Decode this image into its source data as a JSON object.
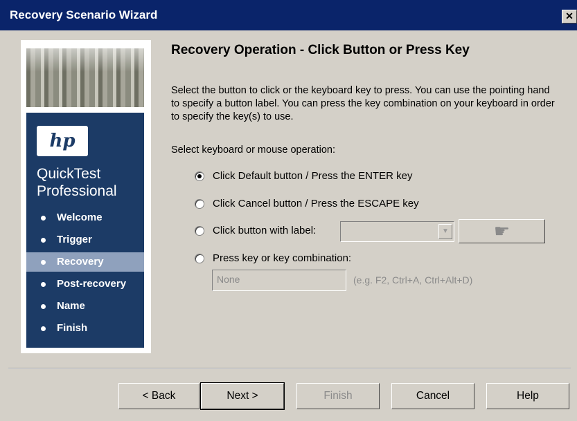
{
  "window": {
    "title": "Recovery Scenario Wizard",
    "close_symbol": "✕"
  },
  "sidebar": {
    "logo_text": "hp",
    "product_line1": "QuickTest",
    "product_line2": "Professional",
    "items": [
      {
        "label": "Welcome",
        "active": false
      },
      {
        "label": "Trigger",
        "active": false
      },
      {
        "label": "Recovery",
        "active": true
      },
      {
        "label": "Post-recovery",
        "active": false
      },
      {
        "label": "Name",
        "active": false
      },
      {
        "label": "Finish",
        "active": false
      }
    ]
  },
  "main": {
    "heading": "Recovery Operation - Click Button or Press Key",
    "description": "Select the button to click or the keyboard key to press. You can use the pointing hand to specify a button label. You can press the key combination on your keyboard in order to specify the key(s) to use.",
    "operation_label": "Select keyboard or mouse operation:",
    "options": [
      {
        "label": "Click Default button / Press the ENTER key",
        "checked": true
      },
      {
        "label": "Click Cancel button / Press the ESCAPE key",
        "checked": false
      },
      {
        "label": "Click button with label:",
        "checked": false
      },
      {
        "label": "Press key or key combination:",
        "checked": false
      }
    ],
    "button_label_combo": {
      "value": ""
    },
    "pointing_hand_icon": "pointing-hand-icon",
    "key_input": {
      "value": "None"
    },
    "key_hint": "(e.g. F2, Ctrl+A, Ctrl+Alt+D)"
  },
  "footer": {
    "back": "< Back",
    "next": "Next >",
    "finish": "Finish",
    "cancel": "Cancel",
    "help": "Help"
  },
  "colors": {
    "titlebar": "#0a246a",
    "sidebar_panel": "#1c3b66",
    "sidebar_active": "#8fa1bd",
    "dialog_bg": "#d4d0c8"
  }
}
